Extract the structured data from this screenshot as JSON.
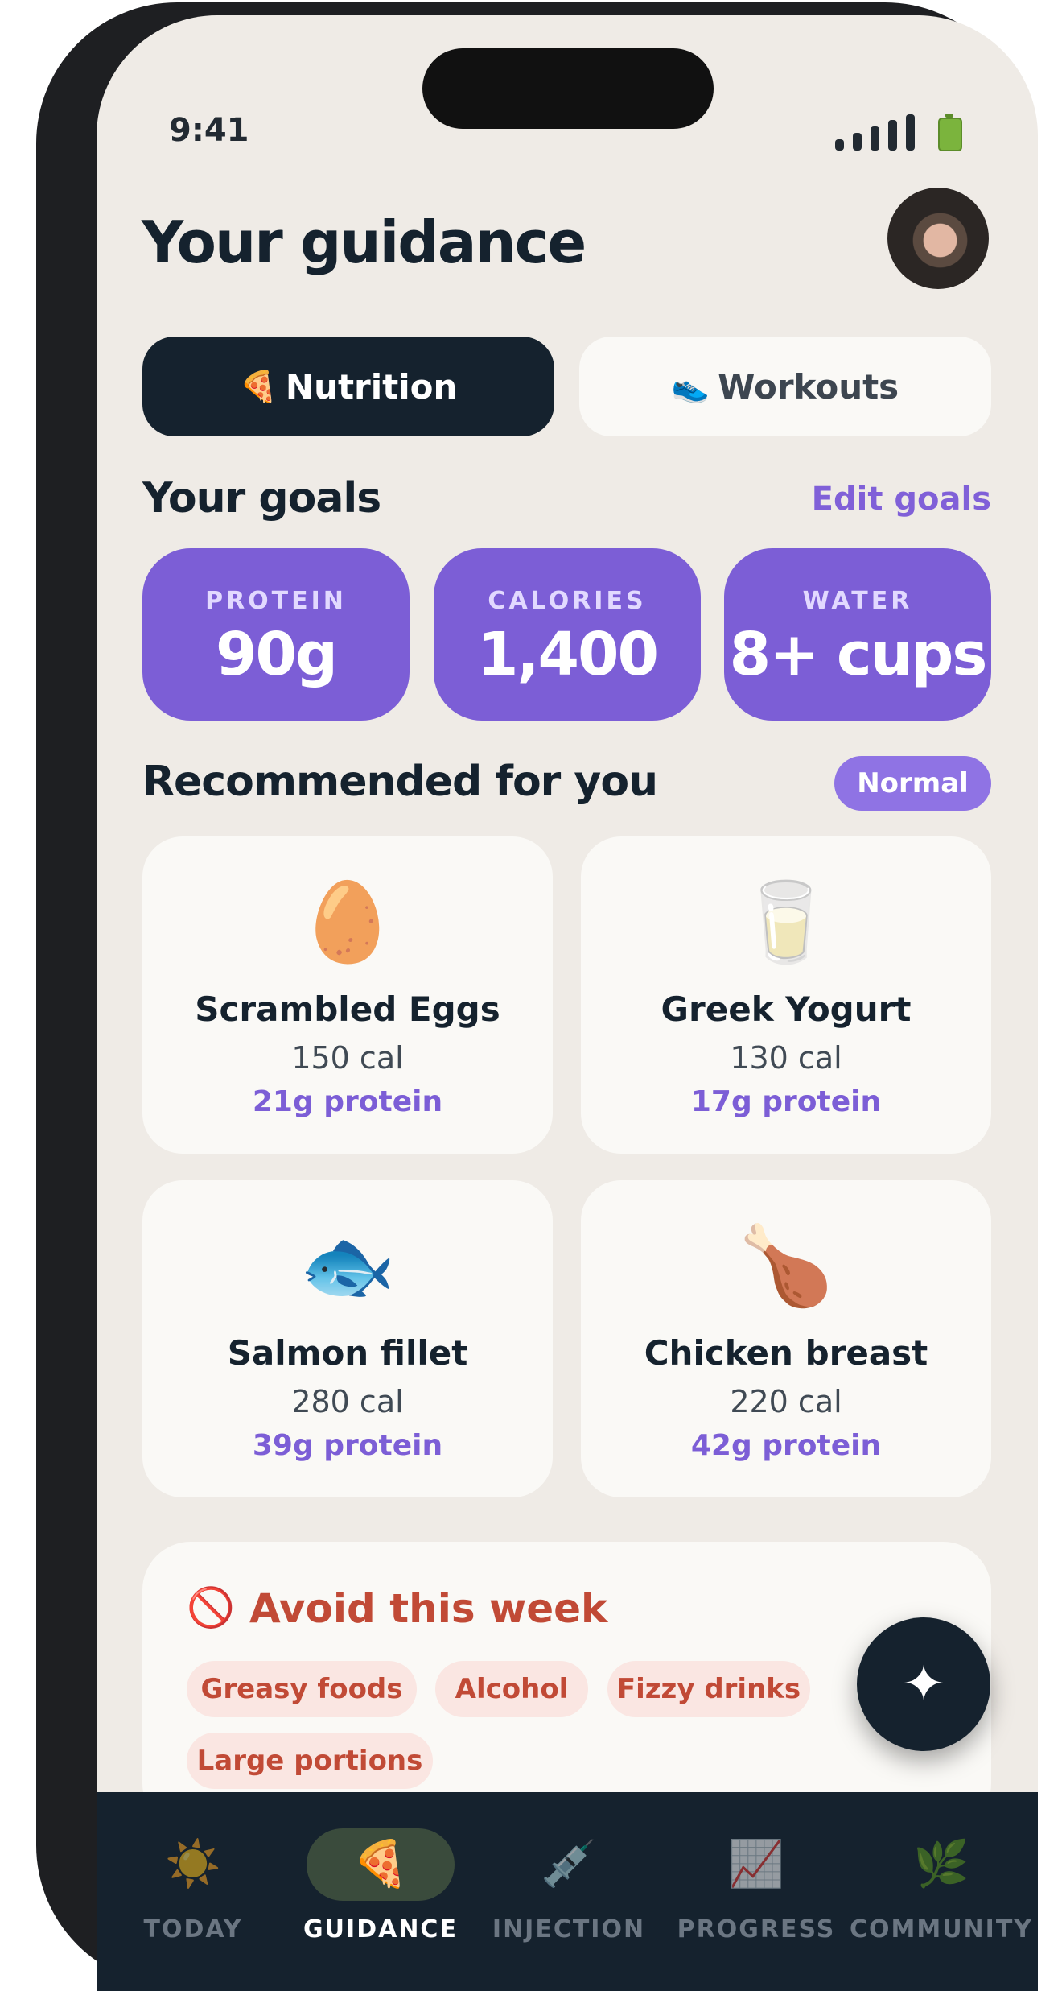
{
  "status_bar": {
    "time": "9:41"
  },
  "header": {
    "title": "Your guidance"
  },
  "segments": [
    {
      "icon": "🍕",
      "label": "Nutrition",
      "active": true
    },
    {
      "icon": "👟",
      "label": "Workouts",
      "active": false
    }
  ],
  "goals": {
    "title": "Your goals",
    "edit_label": "Edit goals",
    "items": [
      {
        "label": "PROTEIN",
        "value": "90g"
      },
      {
        "label": "CALORIES",
        "value": "1,400"
      },
      {
        "label": "WATER",
        "value": "8+ cups"
      }
    ]
  },
  "recommended": {
    "title": "Recommended for you",
    "badge": "Normal",
    "items": [
      {
        "icon": "🥚",
        "name": "Scrambled Eggs",
        "calories": "150 cal",
        "protein": "21g protein"
      },
      {
        "icon": "🥛",
        "name": "Greek Yogurt",
        "calories": "130 cal",
        "protein": "17g protein"
      },
      {
        "icon": "🐟",
        "name": "Salmon fillet",
        "calories": "280 cal",
        "protein": "39g protein"
      },
      {
        "icon": "🍗",
        "name": "Chicken breast",
        "calories": "220 cal",
        "protein": "42g protein"
      }
    ]
  },
  "avoid": {
    "icon": "🚫",
    "title": "Avoid this week",
    "tags": [
      "Greasy foods",
      "Alcohol",
      "Fizzy drinks",
      "Large portions"
    ]
  },
  "fab": {
    "icon": "✦"
  },
  "nav": {
    "items": [
      {
        "icon": "☀️",
        "label": "TODAY"
      },
      {
        "icon": "🍕",
        "label": "GUIDANCE"
      },
      {
        "icon": "💉",
        "label": "INJECTION"
      },
      {
        "icon": "📈",
        "label": "PROGRESS"
      },
      {
        "icon": "🌿",
        "label": "COMMUNITY"
      }
    ]
  }
}
